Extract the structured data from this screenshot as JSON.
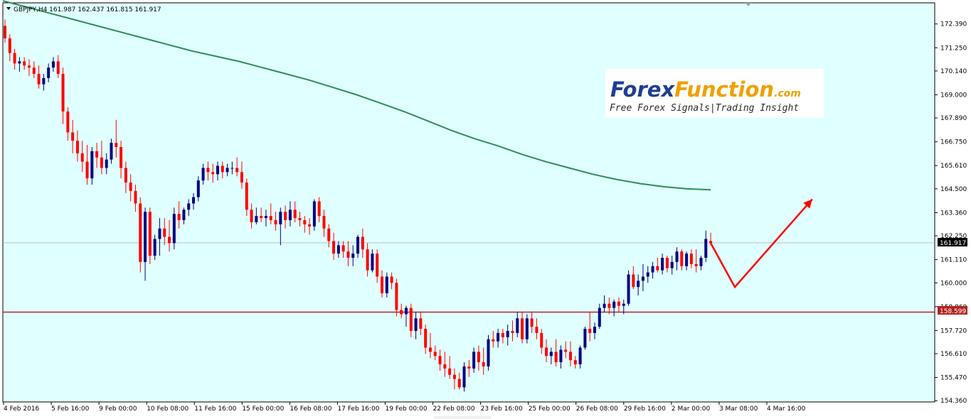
{
  "chart_data": {
    "type": "candlestick",
    "symbol_header": "GBPJPY,H4  161.987 162.437 161.815 161.917",
    "ylim": [
      154.3,
      173.4
    ],
    "y_ticks": [
      "172.390",
      "171.250",
      "170.140",
      "169.000",
      "167.890",
      "166.750",
      "165.610",
      "164.500",
      "163.360",
      "162.250",
      "161.110",
      "160.000",
      "158.860",
      "157.720",
      "156.610",
      "155.470",
      "154.360"
    ],
    "x_ticks": [
      "4 Feb 2016",
      "5 Feb 16:00",
      "9 Feb 00:00",
      "10 Feb 08:00",
      "11 Feb 16:00",
      "15 Feb 00:00",
      "16 Feb 08:00",
      "17 Feb 16:00",
      "19 Feb 00:00",
      "22 Feb 08:00",
      "23 Feb 16:00",
      "25 Feb 00:00",
      "26 Feb 08:00",
      "29 Feb 16:00",
      "2 Mar 00:00",
      "3 Mar 08:00",
      "4 Mar 16:00"
    ],
    "current_price": "161.917",
    "level_price": "158.599",
    "level_value": 158.599,
    "ma_values": [
      173.5,
      173.2,
      172.9,
      172.6,
      172.3,
      172.0,
      171.7,
      171.4,
      171.1,
      170.85,
      170.6,
      170.3,
      170.0,
      169.7,
      169.35,
      169.0,
      168.6,
      168.2,
      167.75,
      167.3,
      166.9,
      166.55,
      166.15,
      165.8,
      165.5,
      165.2,
      164.95,
      164.75,
      164.6,
      164.5,
      164.45
    ],
    "candles": [
      [
        172.3,
        172.6,
        171.5,
        171.7
      ],
      [
        171.7,
        171.9,
        170.6,
        171.0
      ],
      [
        171.0,
        171.2,
        170.2,
        170.5
      ],
      [
        170.5,
        170.8,
        170.1,
        170.6
      ],
      [
        170.6,
        170.8,
        170.2,
        170.4
      ],
      [
        170.4,
        170.7,
        169.9,
        170.3
      ],
      [
        170.3,
        170.6,
        169.8,
        170.0
      ],
      [
        170.0,
        170.4,
        169.3,
        169.5
      ],
      [
        169.5,
        170.0,
        169.2,
        169.8
      ],
      [
        169.8,
        170.5,
        169.6,
        170.3
      ],
      [
        170.3,
        170.8,
        170.1,
        170.6
      ],
      [
        170.6,
        170.9,
        169.8,
        170.0
      ],
      [
        170.0,
        170.3,
        167.6,
        168.2
      ],
      [
        168.2,
        168.4,
        166.8,
        167.2
      ],
      [
        167.2,
        167.8,
        166.2,
        166.8
      ],
      [
        166.8,
        167.3,
        165.8,
        166.2
      ],
      [
        166.2,
        166.8,
        165.3,
        165.8
      ],
      [
        165.8,
        166.6,
        164.7,
        165.0
      ],
      [
        165.0,
        166.5,
        164.7,
        166.3
      ],
      [
        166.3,
        166.7,
        165.5,
        166.0
      ],
      [
        166.0,
        166.8,
        165.2,
        165.5
      ],
      [
        165.5,
        166.2,
        165.2,
        165.9
      ],
      [
        165.9,
        166.9,
        165.7,
        166.7
      ],
      [
        166.7,
        167.8,
        166.0,
        166.5
      ],
      [
        166.5,
        166.8,
        165.0,
        165.5
      ],
      [
        165.5,
        165.8,
        164.3,
        164.8
      ],
      [
        164.8,
        165.2,
        163.9,
        164.4
      ],
      [
        164.4,
        164.7,
        163.4,
        163.8
      ],
      [
        163.8,
        164.1,
        160.5,
        161.0
      ],
      [
        161.0,
        163.6,
        160.1,
        163.4
      ],
      [
        163.4,
        163.6,
        160.9,
        161.3
      ],
      [
        161.3,
        162.3,
        161.1,
        162.1
      ],
      [
        162.1,
        163.1,
        161.3,
        162.6
      ],
      [
        162.6,
        163.1,
        161.8,
        162.2
      ],
      [
        162.2,
        163.0,
        161.5,
        161.9
      ],
      [
        161.9,
        163.6,
        161.6,
        163.3
      ],
      [
        163.3,
        163.9,
        162.6,
        163.0
      ],
      [
        163.0,
        163.6,
        162.8,
        163.5
      ],
      [
        163.5,
        164.0,
        163.2,
        163.8
      ],
      [
        163.8,
        164.3,
        163.5,
        164.1
      ],
      [
        164.1,
        165.1,
        163.9,
        164.9
      ],
      [
        164.9,
        165.7,
        164.7,
        165.5
      ],
      [
        165.5,
        165.8,
        164.9,
        165.3
      ],
      [
        165.3,
        165.7,
        164.8,
        165.2
      ],
      [
        165.2,
        165.8,
        164.9,
        165.6
      ],
      [
        165.6,
        165.8,
        165.0,
        165.3
      ],
      [
        165.3,
        165.7,
        165.1,
        165.5
      ],
      [
        165.5,
        165.8,
        165.2,
        165.5
      ],
      [
        165.5,
        166.0,
        165.1,
        165.3
      ],
      [
        165.3,
        165.8,
        164.5,
        164.8
      ],
      [
        164.8,
        165.0,
        163.2,
        163.5
      ],
      [
        163.5,
        163.8,
        162.6,
        162.9
      ],
      [
        162.9,
        163.6,
        162.8,
        163.2
      ],
      [
        163.2,
        163.6,
        162.9,
        163.1
      ],
      [
        163.1,
        163.5,
        162.7,
        163.2
      ],
      [
        163.2,
        163.8,
        162.8,
        163.0
      ],
      [
        163.0,
        163.4,
        162.5,
        162.8
      ],
      [
        162.8,
        163.6,
        161.8,
        163.4
      ],
      [
        163.4,
        163.7,
        162.6,
        163.0
      ],
      [
        163.0,
        163.9,
        162.7,
        163.5
      ],
      [
        163.5,
        163.9,
        162.9,
        163.1
      ],
      [
        163.1,
        163.4,
        162.7,
        163.0
      ],
      [
        163.0,
        163.2,
        162.4,
        162.8
      ],
      [
        162.8,
        163.1,
        162.3,
        162.7
      ],
      [
        162.7,
        164.0,
        162.5,
        163.9
      ],
      [
        163.9,
        164.1,
        162.9,
        163.2
      ],
      [
        163.2,
        163.5,
        162.2,
        162.6
      ],
      [
        162.6,
        162.8,
        161.7,
        162.0
      ],
      [
        162.0,
        162.4,
        161.1,
        161.4
      ],
      [
        161.4,
        162.0,
        161.2,
        161.8
      ],
      [
        161.8,
        162.0,
        161.2,
        161.5
      ],
      [
        161.5,
        162.0,
        160.8,
        161.2
      ],
      [
        161.2,
        161.8,
        160.8,
        161.4
      ],
      [
        161.4,
        162.3,
        161.2,
        162.2
      ],
      [
        162.2,
        162.6,
        161.2,
        161.6
      ],
      [
        161.6,
        161.9,
        160.3,
        160.6
      ],
      [
        160.6,
        161.6,
        160.5,
        161.4
      ],
      [
        161.4,
        161.6,
        160.0,
        160.3
      ],
      [
        160.3,
        160.6,
        159.3,
        159.5
      ],
      [
        159.5,
        160.5,
        159.3,
        160.3
      ],
      [
        160.3,
        160.5,
        159.7,
        160.0
      ],
      [
        160.0,
        160.2,
        158.4,
        158.7
      ],
      [
        158.7,
        159.0,
        158.3,
        158.5
      ],
      [
        158.5,
        158.9,
        157.9,
        158.8
      ],
      [
        158.8,
        159.0,
        157.4,
        157.7
      ],
      [
        157.7,
        158.6,
        157.3,
        158.3
      ],
      [
        158.3,
        158.6,
        157.5,
        157.8
      ],
      [
        157.8,
        158.0,
        156.6,
        156.9
      ],
      [
        156.9,
        157.6,
        156.4,
        156.7
      ],
      [
        156.7,
        157.0,
        156.3,
        156.5
      ],
      [
        156.5,
        156.8,
        155.8,
        156.1
      ],
      [
        156.1,
        156.7,
        155.5,
        155.9
      ],
      [
        155.9,
        156.5,
        155.4,
        155.6
      ],
      [
        155.6,
        155.9,
        154.9,
        155.4
      ],
      [
        155.4,
        155.7,
        154.9,
        155.0
      ],
      [
        155.0,
        156.2,
        154.8,
        156.0
      ],
      [
        156.0,
        156.3,
        155.5,
        155.9
      ],
      [
        155.9,
        156.9,
        155.7,
        156.7
      ],
      [
        156.7,
        157.0,
        155.8,
        156.2
      ],
      [
        156.2,
        156.9,
        155.6,
        156.0
      ],
      [
        156.0,
        157.5,
        155.8,
        157.3
      ],
      [
        157.3,
        157.7,
        156.9,
        157.2
      ],
      [
        157.2,
        157.8,
        156.9,
        157.6
      ],
      [
        157.6,
        157.8,
        157.1,
        157.4
      ],
      [
        157.4,
        158.0,
        157.0,
        157.7
      ],
      [
        157.7,
        158.2,
        157.2,
        157.6
      ],
      [
        157.6,
        158.6,
        157.4,
        158.3
      ],
      [
        158.3,
        158.6,
        157.1,
        157.3
      ],
      [
        157.3,
        158.5,
        157.1,
        158.3
      ],
      [
        158.3,
        158.6,
        157.6,
        157.9
      ],
      [
        157.9,
        158.3,
        157.3,
        157.6
      ],
      [
        157.6,
        157.8,
        156.6,
        156.9
      ],
      [
        156.9,
        157.3,
        156.2,
        156.5
      ],
      [
        156.5,
        156.9,
        156.1,
        156.7
      ],
      [
        156.7,
        157.3,
        156.0,
        156.2
      ],
      [
        156.2,
        157.0,
        155.9,
        156.8
      ],
      [
        156.8,
        157.2,
        156.4,
        156.7
      ],
      [
        156.7,
        157.2,
        156.0,
        156.3
      ],
      [
        156.3,
        156.5,
        155.9,
        156.1
      ],
      [
        156.1,
        157.0,
        155.9,
        156.9
      ],
      [
        156.9,
        157.9,
        156.8,
        157.8
      ],
      [
        157.8,
        158.6,
        157.2,
        157.6
      ],
      [
        157.6,
        158.1,
        157.3,
        157.9
      ],
      [
        157.9,
        159.0,
        157.8,
        158.8
      ],
      [
        158.8,
        159.4,
        158.6,
        159.0
      ],
      [
        159.0,
        159.3,
        158.5,
        158.8
      ],
      [
        158.8,
        159.2,
        158.4,
        159.1
      ],
      [
        159.1,
        159.3,
        158.6,
        158.9
      ],
      [
        158.9,
        159.2,
        158.5,
        159.0
      ],
      [
        159.0,
        160.6,
        158.9,
        160.4
      ],
      [
        160.4,
        160.8,
        159.7,
        159.8
      ],
      [
        159.8,
        160.4,
        159.4,
        160.1
      ],
      [
        160.1,
        160.9,
        159.6,
        160.3
      ],
      [
        160.3,
        160.8,
        160.0,
        160.5
      ],
      [
        160.5,
        161.0,
        160.2,
        160.8
      ],
      [
        160.8,
        161.2,
        160.5,
        160.6
      ],
      [
        160.6,
        161.4,
        160.4,
        161.2
      ],
      [
        161.2,
        161.3,
        160.5,
        160.7
      ],
      [
        160.7,
        161.3,
        160.4,
        161.0
      ],
      [
        161.0,
        161.7,
        160.6,
        161.5
      ],
      [
        161.5,
        161.6,
        160.6,
        160.8
      ],
      [
        160.8,
        161.5,
        160.6,
        161.4
      ],
      [
        161.4,
        161.6,
        160.7,
        160.9
      ],
      [
        160.9,
        161.6,
        160.5,
        160.8
      ],
      [
        160.8,
        161.3,
        160.6,
        161.2
      ],
      [
        161.2,
        162.5,
        161.0,
        162.1
      ],
      [
        162.0,
        162.4,
        161.8,
        161.9
      ]
    ],
    "forecast_path": [
      [
        161.9,
        0
      ],
      [
        159.8,
        5
      ],
      [
        164.0,
        21
      ]
    ]
  },
  "logo": {
    "brand_part1": "Forex",
    "brand_part2": "Function",
    "domain": ".com",
    "tagline": "Free Forex Signals|Trading Insight"
  },
  "colors": {
    "background": "#e0ffff",
    "bull": "#000080",
    "bear": "#ff0000",
    "ma_line": "#2e8b57",
    "level_line": "#b22222",
    "forecast_arrow": "#ff0000"
  }
}
